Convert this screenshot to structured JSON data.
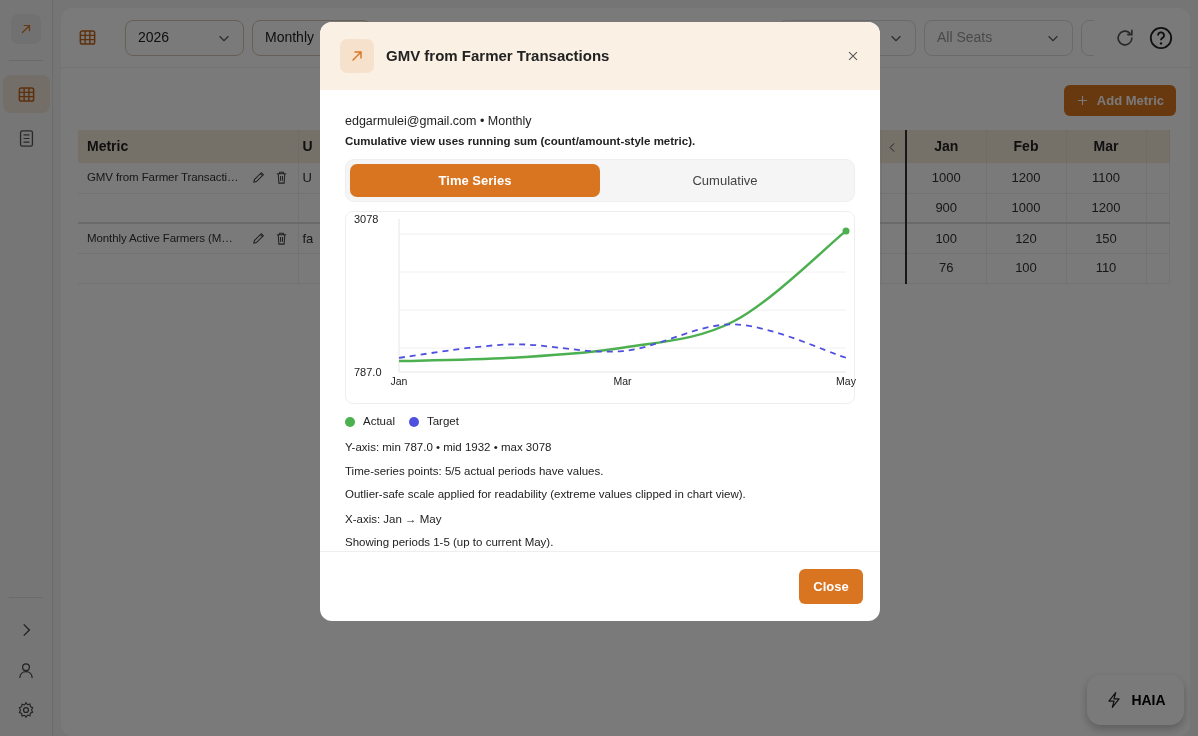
{
  "sidebar": {
    "items": [
      {
        "kind": "table",
        "selected": true
      },
      {
        "kind": "document",
        "selected": false
      }
    ]
  },
  "toolbar": {
    "filters": [
      {
        "kind": "value",
        "text": "2026"
      },
      {
        "kind": "partial",
        "text": "Monthly"
      },
      {
        "kind": "blank"
      },
      {
        "kind": "placeholder",
        "text": "All Seats"
      },
      {
        "kind": "cut"
      }
    ]
  },
  "add_metric_button": {
    "label": "Add Metric"
  },
  "table": {
    "columns": [
      {
        "kind": "text",
        "label": "Metric"
      },
      {
        "kind": "text",
        "label": "U"
      },
      {
        "kind": "blank"
      },
      {
        "kind": "collapse"
      },
      {
        "kind": "month",
        "label": "Jan"
      },
      {
        "kind": "month",
        "label": "Feb"
      },
      {
        "kind": "month",
        "label": "Mar"
      },
      {
        "kind": "blank"
      }
    ],
    "metrics": [
      {
        "name": "GMV from Farmer Transacti…",
        "column_2": "U",
        "rows": [
          [
            "1000",
            "1200",
            "1100"
          ],
          [
            "900",
            "1000",
            "1200"
          ]
        ]
      },
      {
        "name": "Monthly Active Farmers (M…",
        "column_2": "fa",
        "rows": [
          [
            "100",
            "120",
            "150"
          ],
          [
            "76",
            "100",
            "110"
          ]
        ]
      }
    ]
  },
  "haia_button": {
    "label": "HAIA"
  },
  "modal": {
    "title": "GMV from Farmer Transactions",
    "subtitle": "edgarmulei@gmail.com • Monthly",
    "note": "Cumulative view uses running sum (count/amount-style metric).",
    "tabs": [
      {
        "label": "Time Series",
        "selected": true
      },
      {
        "label": "Cumulative",
        "selected": false
      }
    ],
    "chart_data": {
      "type": "line",
      "categories": [
        "Jan",
        null,
        "Mar",
        null,
        "May"
      ],
      "ylim": [
        787,
        3078
      ],
      "yticks": [
        {
          "value": 787,
          "label": "787.0"
        },
        {
          "value": 3078,
          "label": "3078"
        }
      ],
      "series": [
        {
          "name": "Actual",
          "color": "#4caf50",
          "line_style": "solid",
          "values": [
            950,
            1000,
            1150,
            1550,
            2900
          ]
        },
        {
          "name": "Target",
          "color": "#5050e0",
          "line_style": "dashed",
          "values": [
            1000,
            1200,
            1100,
            1500,
            1000
          ]
        }
      ]
    },
    "info": [
      "Y-axis: min 787.0 • mid 1932 • max 3078",
      "Time-series points: 5/5 actual periods have values.",
      "Outlier-safe scale applied for readability (extreme values clipped in chart view).",
      "X-axis: Jan → May",
      "Showing periods 1-5 (up to current May)."
    ],
    "close_button": "Close"
  }
}
